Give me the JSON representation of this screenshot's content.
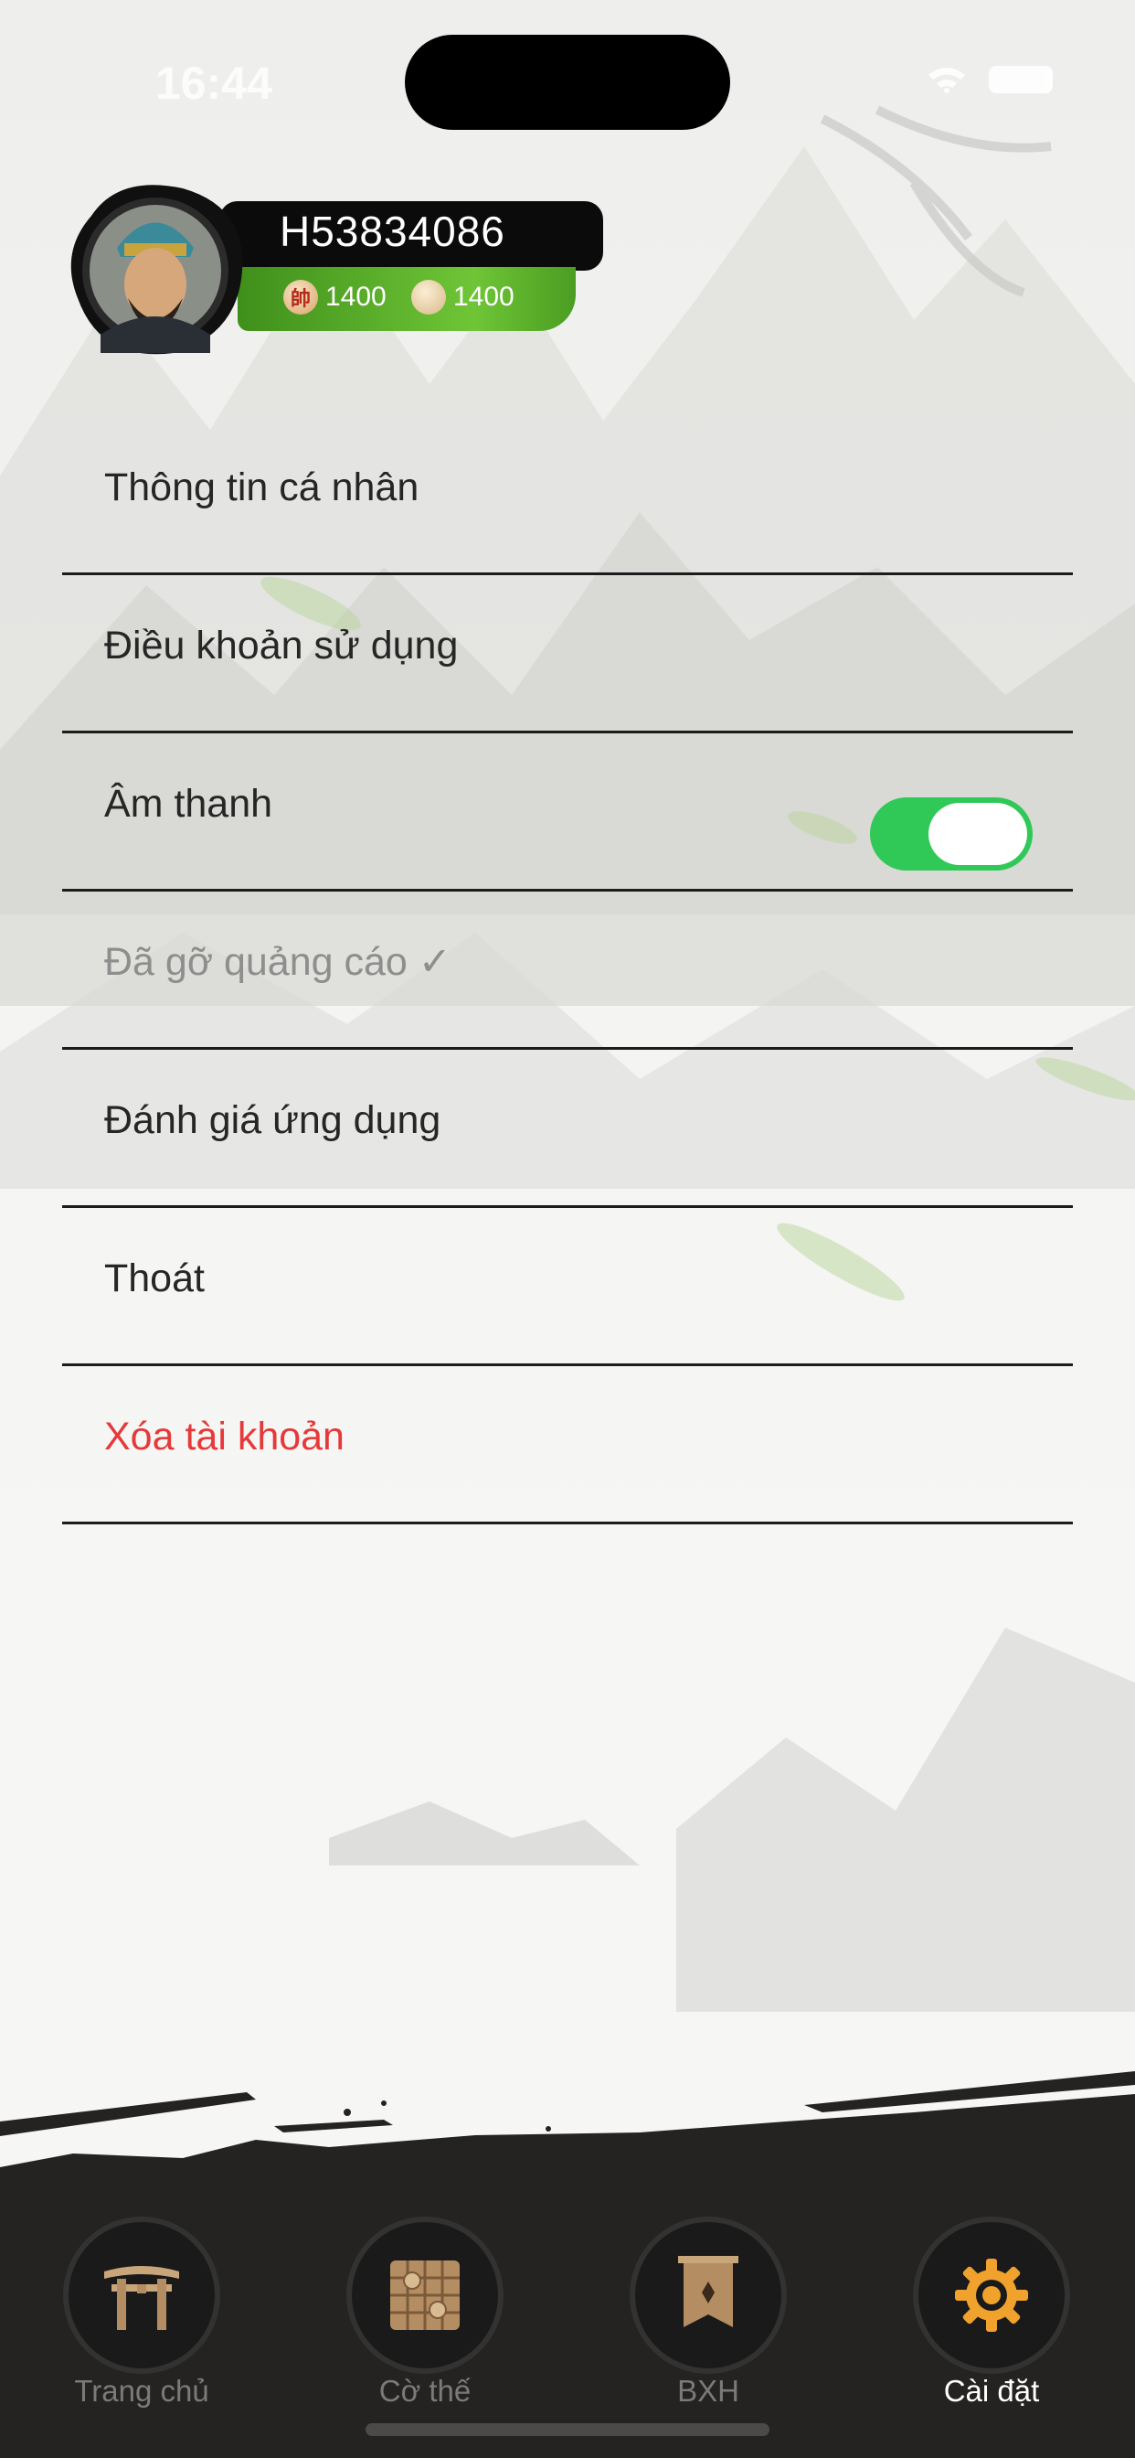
{
  "status_bar": {
    "time": "16:44"
  },
  "profile": {
    "name": "H53834086",
    "currency": [
      {
        "icon": "general-coin-icon",
        "glyph": "帥",
        "value": "1400"
      },
      {
        "icon": "gold-coin-icon",
        "value": "1400"
      }
    ]
  },
  "menu": {
    "items": [
      {
        "label": "Thông tin cá nhân"
      },
      {
        "label": "Điều khoản sử dụng"
      },
      {
        "label": "Âm thanh",
        "toggle_on": true
      },
      {
        "label": "Đã gỡ quảng cáo ✓"
      },
      {
        "label": "Đánh giá ứng dụng"
      },
      {
        "label": "Thoát"
      },
      {
        "label": "Xóa tài khoản"
      }
    ]
  },
  "colors": {
    "toggle_on": "#30c857",
    "danger": "#e5393a",
    "accent_green": "#6fc536"
  },
  "tabs": [
    {
      "label": "Trang chủ",
      "icon": "gate-icon"
    },
    {
      "label": "Cờ thế",
      "icon": "chessboard-icon"
    },
    {
      "label": "BXH",
      "icon": "banner-icon"
    },
    {
      "label": "Cài đặt",
      "icon": "gear-icon",
      "active": true
    }
  ]
}
